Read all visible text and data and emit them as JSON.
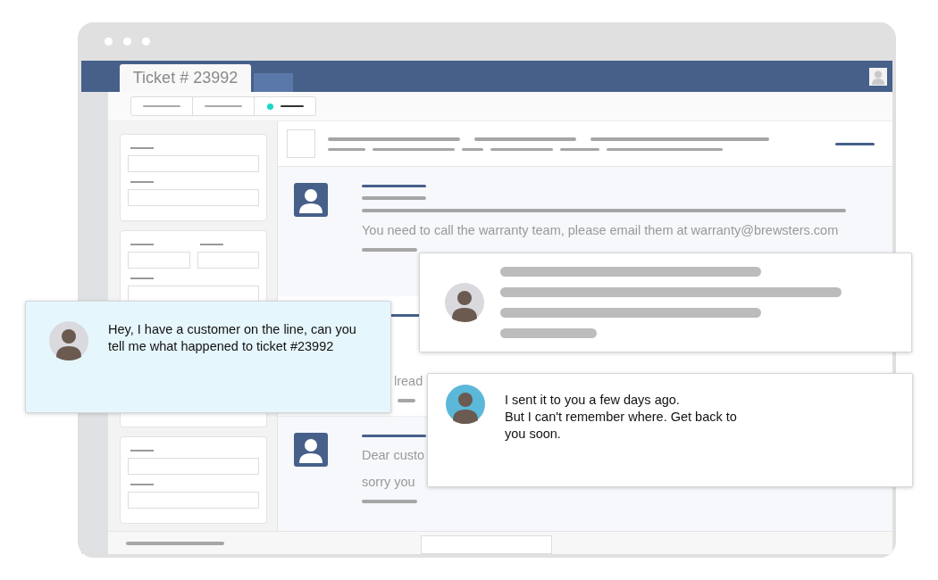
{
  "window": {
    "tab": {
      "label": "Ticket # 23992",
      "selected": true
    }
  },
  "toolbar": {
    "segments": [
      {
        "selected": false
      },
      {
        "selected": false
      },
      {
        "selected": true
      }
    ]
  },
  "thread": [
    {
      "kind": "text",
      "lines": [
        "You need to call the warranty team, please email them at warranty@brewsters.com"
      ]
    },
    {
      "kind": "covered",
      "lines": [
        "lread"
      ]
    },
    {
      "kind": "text",
      "lines": [
        "Dear custo",
        "sorry you"
      ]
    }
  ],
  "chats": [
    {
      "kind": "message",
      "highlighted": true,
      "text": "Hey, I have a customer on the line, can you tell me what happened to ticket #23992"
    },
    {
      "kind": "placeholder",
      "highlighted": false
    },
    {
      "kind": "message",
      "highlighted": false,
      "text": "I sent it to you a few days ago.\nBut I can't remember where. Get back to you soon."
    }
  ]
}
